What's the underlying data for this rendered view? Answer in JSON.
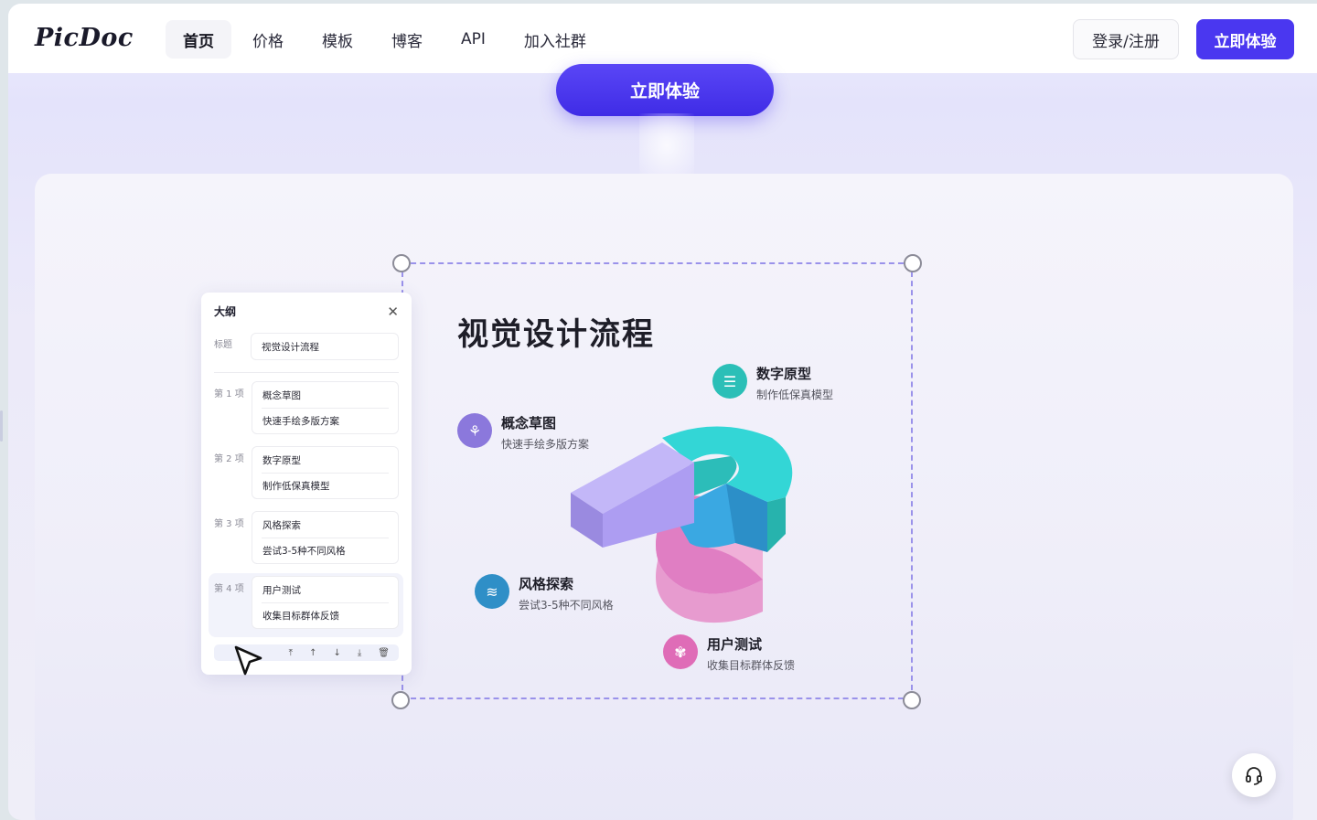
{
  "brand": {
    "logo": "PicDoc",
    "accent": "#4a37f0"
  },
  "nav": {
    "items": [
      {
        "label": "首页",
        "active": true
      },
      {
        "label": "价格",
        "active": false
      },
      {
        "label": "模板",
        "active": false
      },
      {
        "label": "博客",
        "active": false
      },
      {
        "label": "API",
        "active": false
      },
      {
        "label": "加入社群",
        "active": false
      }
    ],
    "login_label": "登录/注册",
    "try_label": "立即体验"
  },
  "hero": {
    "cta_label": "立即体验"
  },
  "outline_panel": {
    "title": "大纲",
    "title_row_label": "标题",
    "title_value": "视觉设计流程",
    "items": [
      {
        "label": "第 1 项",
        "name": "概念草图",
        "desc": "快速手绘多版方案"
      },
      {
        "label": "第 2 项",
        "name": "数字原型",
        "desc": "制作低保真模型"
      },
      {
        "label": "第 3 项",
        "name": "风格探索",
        "desc": "尝试3-5种不同风格"
      },
      {
        "label": "第 4 项",
        "name": "用户测试",
        "desc": "收集目标群体反馈"
      }
    ],
    "toolbar_icons": [
      "move-top-icon",
      "move-up-icon",
      "move-down-icon",
      "move-bottom-icon",
      "trash-icon"
    ]
  },
  "diagram": {
    "title": "视觉设计流程",
    "steps": [
      {
        "name": "数字原型",
        "desc": "制作低保真模型",
        "color": "#2bbfb7"
      },
      {
        "name": "概念草图",
        "desc": "快速手绘多版方案",
        "color": "#8b78dc"
      },
      {
        "name": "风格探索",
        "desc": "尝试3-5种不同风格",
        "color": "#2f8fc7"
      },
      {
        "name": "用户测试",
        "desc": "收集目标群体反馈",
        "color": "#df6cb7"
      }
    ]
  }
}
